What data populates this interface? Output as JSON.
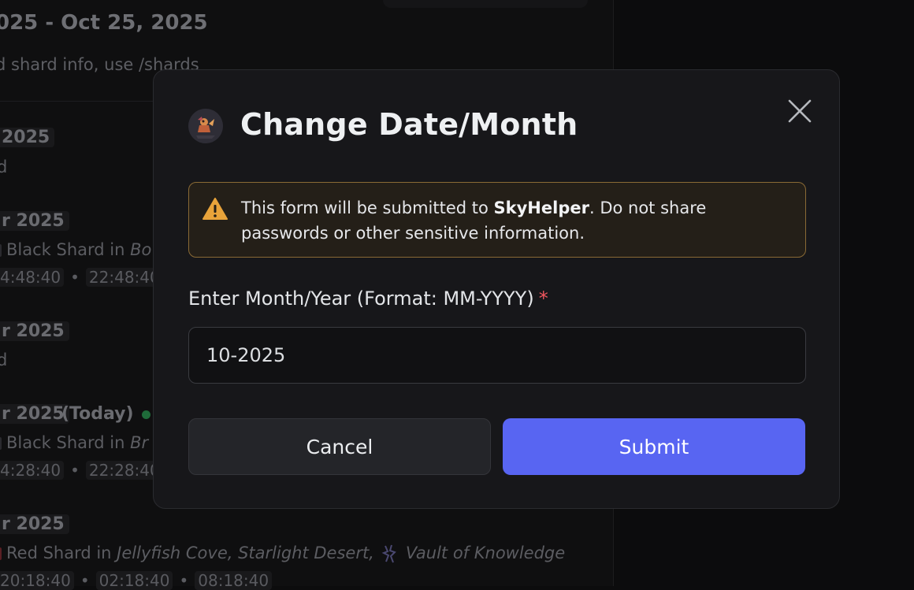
{
  "background": {
    "header_title": "025 - Oct 25, 2025",
    "header_sub": "d shard info, use /shards",
    "entries": [
      {
        "date": " 2025",
        "line": "d"
      },
      {
        "date": "r 2025",
        "shard_prefix": "Black Shard in ",
        "location": "Bo",
        "times": [
          "4:48:40",
          "22:48:40"
        ]
      },
      {
        "date": "r 2025",
        "line": "d"
      },
      {
        "date": "r 2025",
        "today": "(Today)",
        "shard_prefix": "Black Shard in ",
        "location": "Br",
        "times": [
          "4:28:40",
          "22:28:40"
        ]
      },
      {
        "date": "r 2025",
        "shard_prefix": "Red Shard in ",
        "location": "Jellyfish Cove, Starlight Desert,",
        "location2": "Vault of Knowledge",
        "times": [
          "20:18:40",
          "02:18:40",
          "08:18:40"
        ]
      }
    ]
  },
  "modal": {
    "title": "Change Date/Month",
    "warning": {
      "prefix": "This form will be submitted to ",
      "bot_name": "SkyHelper",
      "suffix": ". Do not share passwords or other sensitive information."
    },
    "field": {
      "label": "Enter Month/Year (Format: MM-YYYY)",
      "required_mark": "*",
      "value": "10-2025"
    },
    "buttons": {
      "cancel": "Cancel",
      "submit": "Submit"
    }
  },
  "colors": {
    "accent": "#5865f2",
    "warning_border": "#8a6a35",
    "warning_icon": "#e8a33a",
    "required": "#f0565e"
  },
  "icons": {
    "close": "close-icon",
    "warning": "warning-icon",
    "avatar": "bot-avatar"
  }
}
